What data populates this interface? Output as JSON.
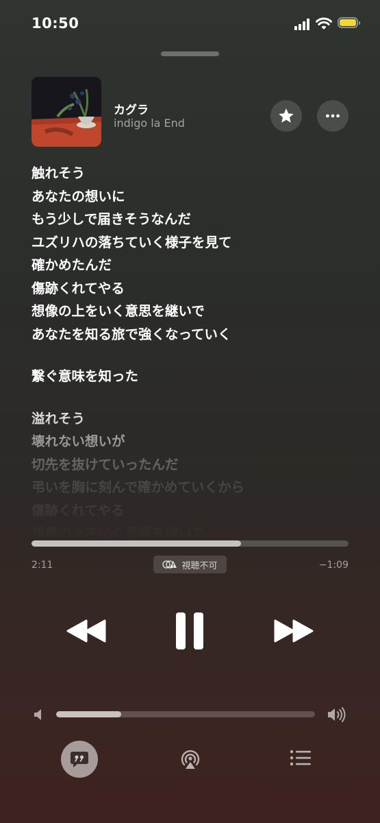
{
  "status_bar": {
    "time": "10:50"
  },
  "now_playing": {
    "title": "カグラ",
    "artist": "indigo la End"
  },
  "lyrics": [
    "触れそう",
    "あなたの想いに",
    "もう少しで届きそうなんだ",
    "ユズリハの落ちていく様子を見て",
    "確かめたんだ",
    "傷跡くれてやる",
    "想像の上をいく意思を継いで",
    "あなたを知る旅で強くなっていく",
    "",
    "繋ぐ意味を知った",
    "",
    "溢れそう",
    "壊れない想いが",
    "切先を抜けていったんだ",
    "弔いを胸に刻んで確かめていくから",
    "傷跡くれてやる",
    "想像の上をいく意思を継いで"
  ],
  "playback": {
    "elapsed": "2:11",
    "remaining": "−1:09",
    "progress": 0.66,
    "badge_label": "視聴不可"
  },
  "volume": {
    "level": 0.25
  },
  "icons": {
    "favorite": "star-icon",
    "more": "ellipsis-icon",
    "rewind": "rewind-icon",
    "pause": "pause-icon",
    "forward": "fast-forward-icon",
    "volume_low": "speaker-low-icon",
    "volume_high": "speaker-high-icon",
    "lyrics": "lyrics-quote-icon",
    "airplay": "airplay-icon",
    "queue": "list-icon"
  },
  "colors": {
    "battery": "#f5d63a"
  }
}
